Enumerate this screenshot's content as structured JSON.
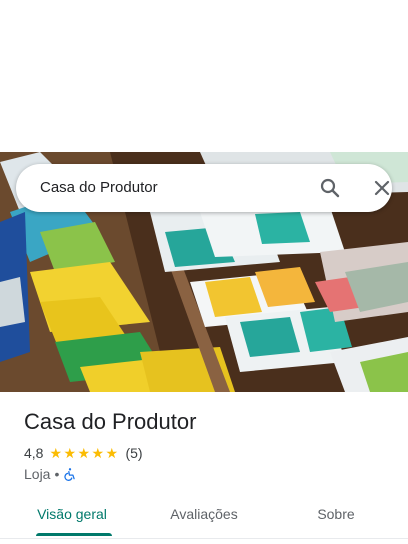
{
  "search": {
    "query": "Casa do Produtor"
  },
  "place": {
    "name": "Casa do Produtor",
    "rating": "4,8",
    "stars": 5,
    "review_count": "(5)",
    "category": "Loja",
    "separator": "•"
  },
  "tabs": [
    {
      "label": "Visão geral",
      "active": true
    },
    {
      "label": "Avaliações",
      "active": false
    },
    {
      "label": "Sobre",
      "active": false
    }
  ],
  "colors": {
    "accent": "#00796b",
    "star": "#fbbc04",
    "wheelchair": "#1a73e8"
  },
  "icons": {
    "search": "search-icon",
    "close": "close-icon",
    "accessibility": "wheelchair-icon",
    "star": "star-icon"
  }
}
